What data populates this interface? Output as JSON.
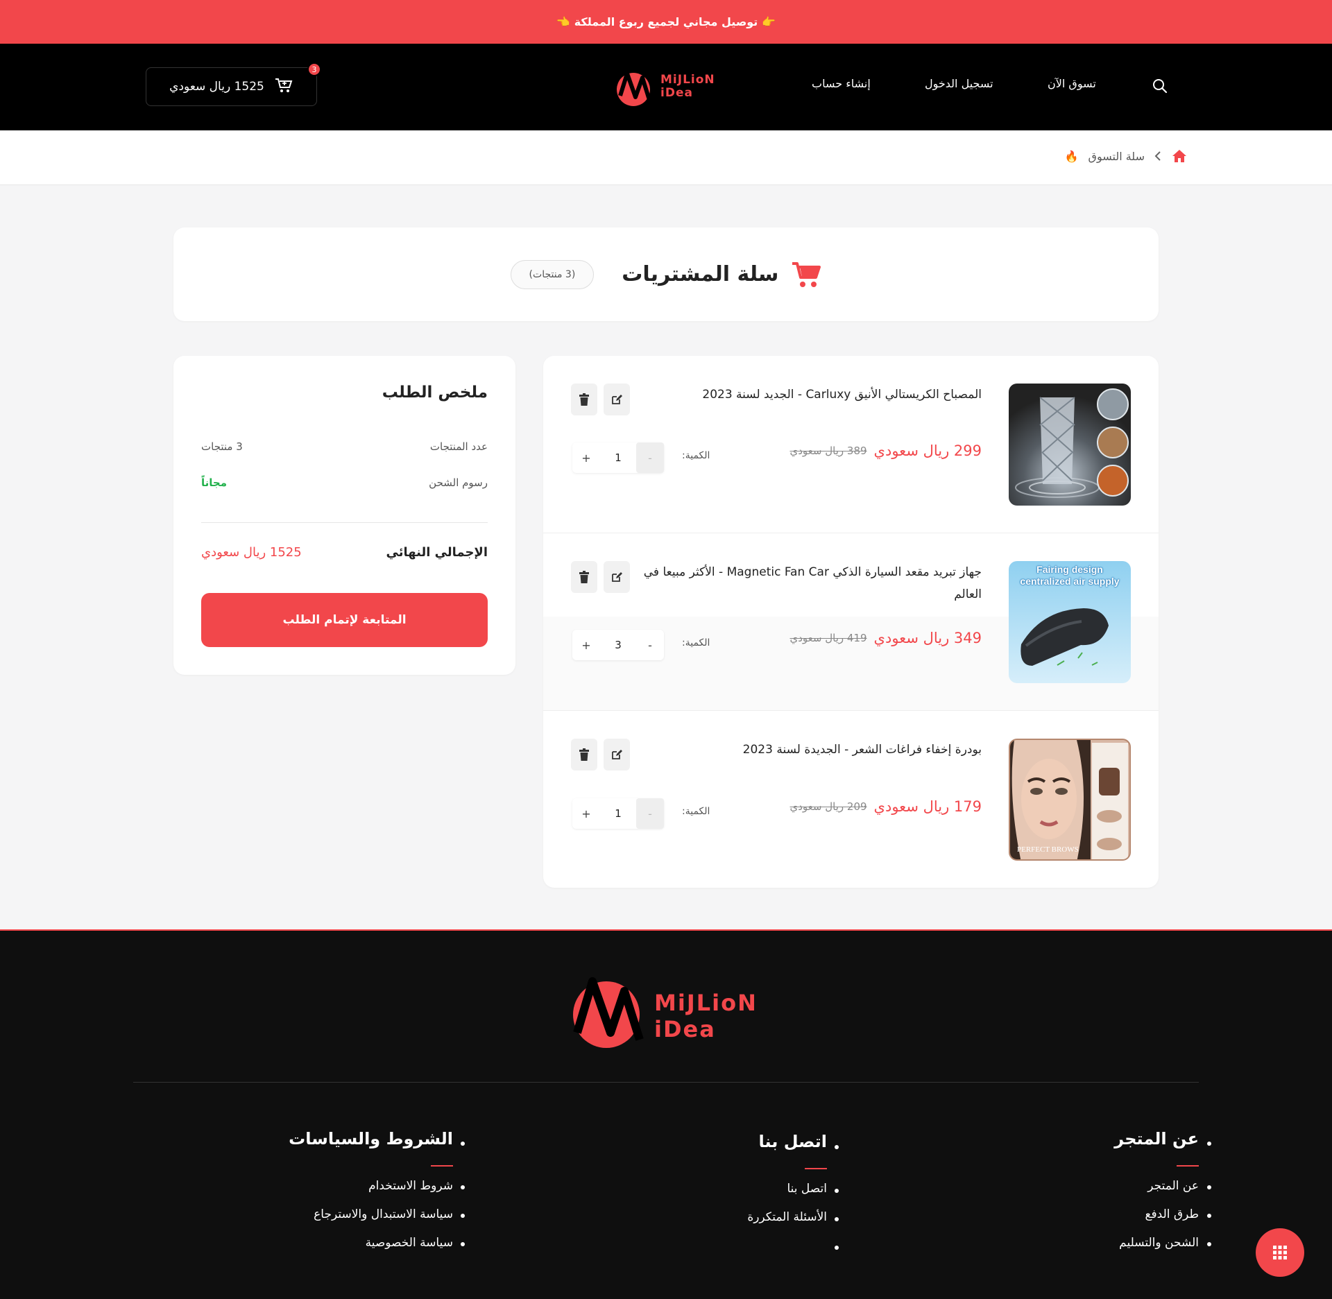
{
  "announcement": {
    "text": "توصيل مجاني لجميع ربوع المملكة",
    "hand_left": "👈",
    "hand_right": "👉"
  },
  "header": {
    "nav": {
      "shop_now": "تسوق الآن",
      "login": "تسجيل الدخول",
      "register": "إنشاء حساب"
    },
    "logo": {
      "line1": "MiJLioN",
      "line2": "iDea"
    },
    "cart": {
      "total": "1525 ريال سعودي",
      "badge": "3"
    }
  },
  "breadcrumb": {
    "current": "سلة التسوق",
    "emoji": "🔥"
  },
  "cart_page": {
    "title": "سلة المشتريات",
    "count_label": "(3 منتجات)"
  },
  "items": [
    {
      "name": "المصباح الكريستالي الأنيق Carluxy - الجديد لسنة 2023",
      "price": "299 ريال سعودي",
      "old_price": "389 ريال سعودي",
      "qty_label": "الكمية:",
      "qty": "1"
    },
    {
      "name": "جهاز تبريد مقعد السيارة الذكي Magnetic Fan Car - الأكثر مبيعا في العالم",
      "price": "349 ريال سعودي",
      "old_price": "419 ريال سعودي",
      "qty_label": "الكمية:",
      "qty": "3",
      "img_text1": "Fairing design",
      "img_text2": "centralized air supply"
    },
    {
      "name": "بودرة إخفاء فراغات الشعر - الجديدة لسنة 2023",
      "price": "179 ريال سعودي",
      "old_price": "209 ريال سعودي",
      "qty_label": "الكمية:",
      "qty": "1",
      "img_text1": "PERFECT BROWS"
    }
  ],
  "summary": {
    "title": "ملخص الطلب",
    "count_label": "عدد المنتجات",
    "count_value": "3 منتجات",
    "shipping_label": "رسوم الشحن",
    "shipping_value": "مجاناً",
    "total_label": "الإجمالي النهائي",
    "total_value": "1525 ريال سعودي",
    "checkout": "المتابعة لإتمام الطلب"
  },
  "footer": {
    "logo": {
      "line1": "MiJLioN",
      "line2": "iDea"
    },
    "about": {
      "title": "عن المتجر",
      "links": [
        "عن المتجر",
        "طرق الدفع",
        "الشحن والتسليم"
      ]
    },
    "contact": {
      "title": "اتصل بنا",
      "links": [
        "اتصل بنا",
        "الأسئلة المتكررة"
      ]
    },
    "policies": {
      "title": "الشروط والسياسات",
      "links": [
        "شروط الاستخدام",
        "سياسة الاستبدال والاسترجاع",
        "سياسة الخصوصية"
      ]
    }
  },
  "colors": {
    "accent": "#f2474b",
    "header_bg": "#000000",
    "footer_bg": "#0f0f0f",
    "success": "#22b14c"
  },
  "icons": [
    "search-icon",
    "cart-icon",
    "home-icon",
    "chevron-left-icon",
    "edit-icon",
    "trash-icon",
    "grid-icon"
  ]
}
